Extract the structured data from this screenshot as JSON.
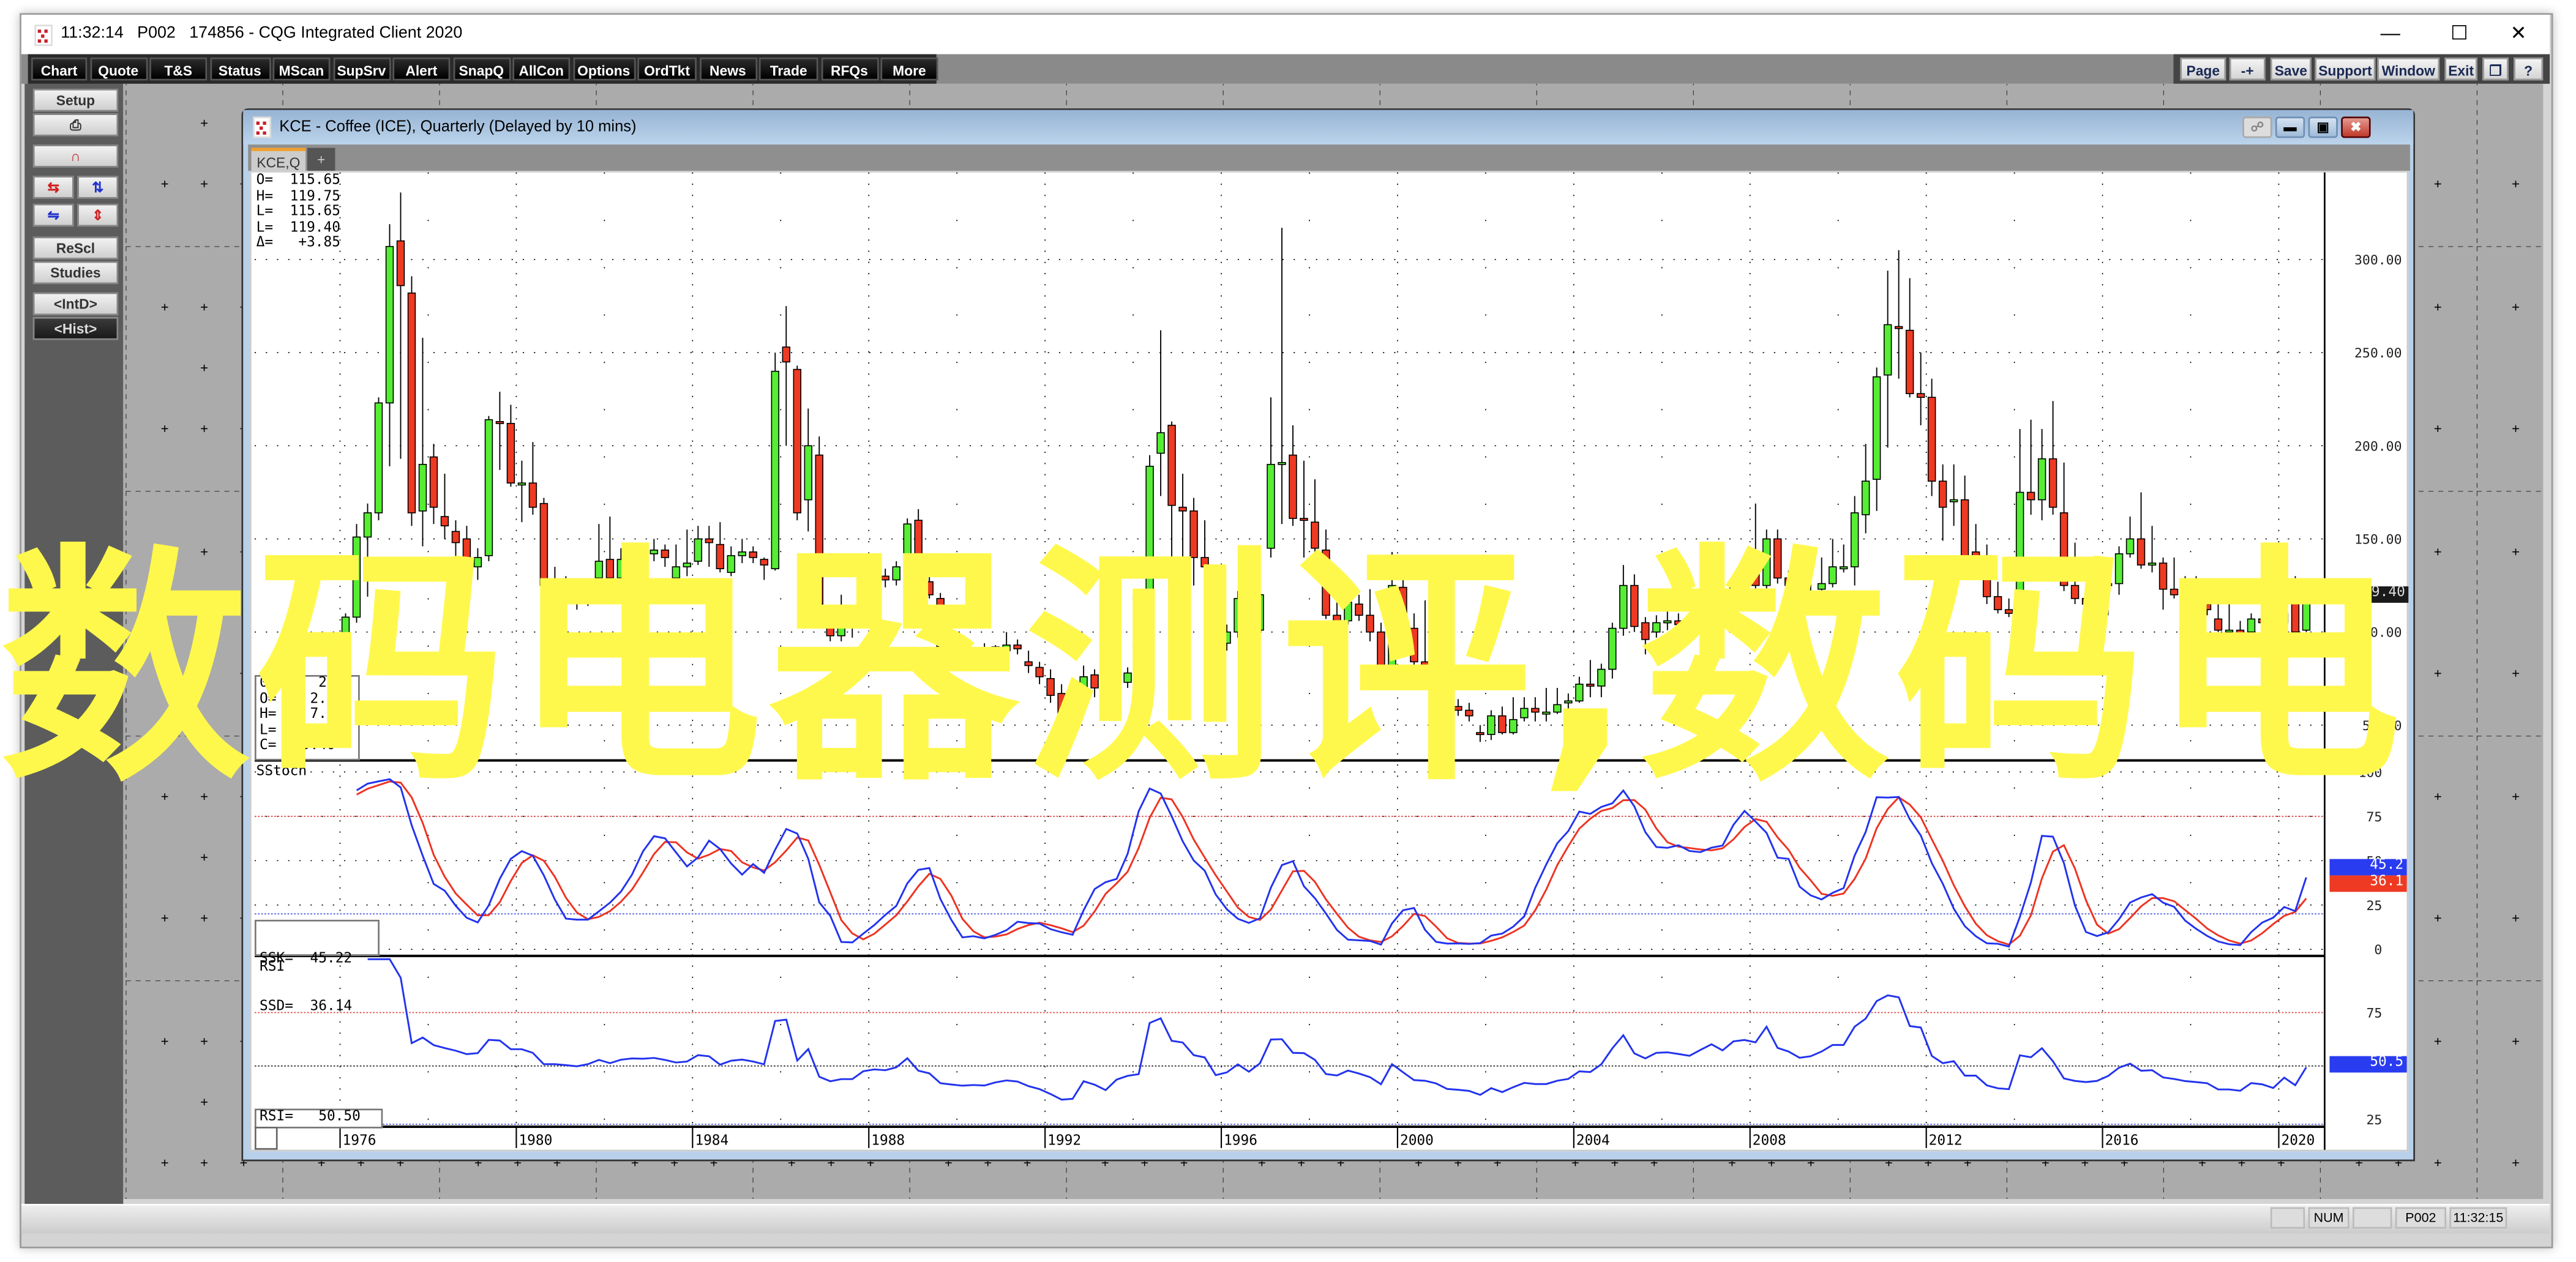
{
  "window": {
    "time": "11:32:14",
    "page": "P002",
    "title": "174856 - CQG Integrated Client 2020",
    "controls": [
      "minimize",
      "maximize",
      "close"
    ]
  },
  "toolbar": {
    "left_buttons": [
      "Chart",
      "Quote",
      "T&S",
      "Status",
      "MScan",
      "SupSrv",
      "Alert",
      "SnapQ",
      "AllCon",
      "Options",
      "OrdTkt",
      "News",
      "Trade",
      "RFQs",
      "More"
    ],
    "right_buttons": [
      "Page",
      "-+",
      "Save",
      "Support",
      "Window",
      "Exit",
      "❐",
      "?"
    ]
  },
  "left_panel": {
    "setup": "Setup",
    "print_icon": "printer-icon",
    "magnet_icon": "magnet-icon",
    "rescl": "ReScl",
    "studies": "Studies",
    "intd": "<IntD>",
    "hist": "<Hist>"
  },
  "chart_window": {
    "title": "KCE - Coffee (ICE), Quarterly (Delayed by 10 mins)",
    "tab": "KCE,Q",
    "add_tab": "+"
  },
  "readout_top": [
    {
      "label": "O=",
      "value": "115.65"
    },
    {
      "label": "H=",
      "value": "119.75"
    },
    {
      "label": "L=",
      "value": "115.65"
    },
    {
      "label": "L=",
      "value": "119.40"
    },
    {
      "label": "Δ=",
      "value": "+3.85"
    }
  ],
  "readout_bottom": [
    {
      "label": "01",
      "value": "20"
    },
    {
      "label": "O=",
      "value": "2.8"
    },
    {
      "label": "H=",
      "value": "7.2"
    },
    {
      "label": "L=",
      "value": ""
    },
    {
      "label": "C=",
      "value": "9.40"
    }
  ],
  "studies": {
    "sstoch_title": "SStoch",
    "ssk_label": "SSK=",
    "ssk_value": "45.22",
    "ssd_label": "SSD=",
    "ssd_value": "36.14",
    "ssk_tag": "45.2",
    "ssd_tag": "36.1",
    "rsi_title": "RSI",
    "rsi_label": "RSI=",
    "rsi_value": "50.50",
    "rsi_tag": "50.5"
  },
  "last_price_tag": "119.40",
  "watermark": "数码电器测评,数码电",
  "status_bar": {
    "num": "NUM",
    "page": "P002",
    "time": "11:32:15"
  },
  "colors": {
    "up": "#55ee33",
    "down": "#ee3a22",
    "ssk": "#2233ee",
    "ssd": "#ee3322",
    "rsi": "#2233ee",
    "watermark": "#fff84c",
    "accent": "#b8d0ea"
  },
  "chart_data": {
    "type": "candlestick",
    "symbol": "KCE",
    "interval": "quarterly",
    "first_bar": "1975-Q4",
    "ylim": [
      31,
      347
    ],
    "y_ticks": [
      "300.00",
      "250.00",
      "200.00",
      "150.00",
      "100.00",
      "50.00"
    ],
    "y_tick_values": [
      300,
      250,
      200,
      150,
      100,
      50
    ],
    "x_ticks": [
      "1976",
      "1980",
      "1984",
      "1988",
      "1992",
      "1996",
      "2000",
      "2004",
      "2008",
      "2012",
      "2016",
      "2020"
    ],
    "grid": true,
    "sstoch_ticks": [
      "100",
      "75",
      "50",
      "25",
      "0"
    ],
    "sstoch_levels": {
      "upper": 75,
      "lower": 20
    },
    "rsi_ticks": [
      "75",
      "25"
    ],
    "rsi_levels": {
      "upper": 75,
      "middle": 50,
      "lower": 25
    },
    "ohlc": [
      [
        79,
        88,
        76,
        86
      ],
      [
        86,
        110,
        84,
        108
      ],
      [
        108,
        158,
        105,
        151
      ],
      [
        151,
        169,
        119,
        164
      ],
      [
        164,
        226,
        160,
        223
      ],
      [
        223,
        319,
        189,
        307
      ],
      [
        310,
        336,
        193,
        286
      ],
      [
        282,
        291,
        157,
        164
      ],
      [
        165,
        258,
        146,
        190
      ],
      [
        194,
        201,
        158,
        167
      ],
      [
        162,
        185,
        150,
        157
      ],
      [
        154,
        160,
        106,
        148
      ],
      [
        150,
        157,
        120,
        135
      ],
      [
        135,
        145,
        128,
        140
      ],
      [
        141,
        216,
        138,
        214
      ],
      [
        213,
        229,
        187,
        212
      ],
      [
        212,
        222,
        178,
        180
      ],
      [
        180,
        192,
        159,
        180
      ],
      [
        180,
        202,
        163,
        167
      ],
      [
        169,
        172,
        117,
        125
      ],
      [
        126,
        135,
        100,
        125
      ],
      [
        125,
        130,
        112,
        122
      ],
      [
        122,
        126,
        112,
        118
      ],
      [
        118,
        128,
        114,
        125
      ],
      [
        129,
        158,
        120,
        138
      ],
      [
        139,
        162,
        120,
        129
      ],
      [
        129,
        145,
        126,
        139
      ],
      [
        138,
        145,
        125,
        143
      ],
      [
        143,
        148,
        136,
        142
      ],
      [
        142,
        150,
        138,
        144
      ],
      [
        144,
        147,
        135,
        140
      ],
      [
        129,
        147,
        125,
        135
      ],
      [
        135,
        155,
        130,
        137
      ],
      [
        138,
        157,
        136,
        150
      ],
      [
        150,
        157,
        135,
        148
      ],
      [
        147,
        159,
        132,
        134
      ],
      [
        132,
        146,
        130,
        141
      ],
      [
        141,
        150,
        137,
        143
      ],
      [
        143,
        146,
        137,
        140
      ],
      [
        139,
        140,
        128,
        136
      ],
      [
        134,
        250,
        133,
        240
      ],
      [
        253,
        275,
        200,
        245
      ],
      [
        241,
        243,
        160,
        164
      ],
      [
        171,
        220,
        154,
        200
      ],
      [
        195,
        205,
        105,
        115
      ],
      [
        110,
        112,
        95,
        98
      ],
      [
        98,
        120,
        95,
        104
      ],
      [
        104,
        110,
        97,
        104
      ],
      [
        117,
        140,
        112,
        125
      ],
      [
        125,
        133,
        120,
        130
      ],
      [
        130,
        134,
        124,
        128
      ],
      [
        128,
        138,
        125,
        135
      ],
      [
        128,
        161,
        120,
        158
      ],
      [
        160,
        166,
        122,
        127
      ],
      [
        127,
        135,
        118,
        120
      ],
      [
        118,
        121,
        88,
        92
      ],
      [
        92,
        95,
        80,
        88
      ],
      [
        88,
        92,
        82,
        85
      ],
      [
        85,
        90,
        82,
        86
      ],
      [
        86,
        94,
        83,
        85
      ],
      [
        92,
        93,
        86,
        90
      ],
      [
        90,
        100,
        88,
        93
      ],
      [
        93,
        96,
        88,
        91
      ],
      [
        84,
        90,
        78,
        82
      ],
      [
        81,
        84,
        72,
        76
      ],
      [
        75,
        80,
        62,
        66
      ],
      [
        67,
        72,
        52,
        54
      ],
      [
        55,
        62,
        50,
        55
      ],
      [
        66,
        82,
        60,
        76
      ],
      [
        77,
        80,
        65,
        70
      ],
      [
        58,
        70,
        53,
        60
      ],
      [
        60,
        80,
        58,
        73
      ],
      [
        73,
        81,
        70,
        78
      ],
      [
        70,
        82,
        68,
        80
      ],
      [
        80,
        195,
        78,
        189
      ],
      [
        196,
        262,
        173,
        207
      ],
      [
        211,
        213,
        118,
        168
      ],
      [
        167,
        185,
        140,
        165
      ],
      [
        165,
        172,
        125,
        140
      ],
      [
        140,
        160,
        130,
        135
      ],
      [
        119,
        130,
        92,
        94
      ],
      [
        94,
        104,
        90,
        100
      ],
      [
        100,
        122,
        97,
        118
      ],
      [
        123,
        136,
        98,
        101
      ],
      [
        101,
        125,
        99,
        120
      ],
      [
        145,
        226,
        140,
        190
      ],
      [
        190,
        317,
        158,
        191
      ],
      [
        195,
        211,
        157,
        161
      ],
      [
        161,
        192,
        140,
        160
      ],
      [
        159,
        182,
        137,
        145
      ],
      [
        144,
        155,
        107,
        109
      ],
      [
        109,
        120,
        100,
        105
      ],
      [
        106,
        125,
        104,
        116
      ],
      [
        115,
        120,
        106,
        109
      ],
      [
        109,
        123,
        95,
        100
      ],
      [
        100,
        105,
        80,
        82
      ],
      [
        82,
        143,
        80,
        125
      ],
      [
        124,
        128,
        102,
        105
      ],
      [
        102,
        110,
        82,
        84
      ],
      [
        84,
        117,
        80,
        82
      ],
      [
        82,
        95,
        72,
        75
      ],
      [
        66,
        70,
        58,
        60
      ],
      [
        60,
        64,
        55,
        58
      ],
      [
        58,
        62,
        52,
        55
      ],
      [
        46,
        50,
        41,
        45
      ],
      [
        45,
        58,
        42,
        55
      ],
      [
        55,
        60,
        45,
        46
      ],
      [
        46,
        65,
        45,
        53
      ],
      [
        54,
        65,
        52,
        59
      ],
      [
        59,
        65,
        52,
        57
      ],
      [
        57,
        70,
        52,
        57
      ],
      [
        57,
        70,
        56,
        61
      ],
      [
        62,
        67,
        55,
        63
      ],
      [
        63,
        76,
        62,
        72
      ],
      [
        72,
        85,
        65,
        71
      ],
      [
        71,
        83,
        65,
        80
      ],
      [
        80,
        105,
        75,
        102
      ],
      [
        102,
        136,
        98,
        125
      ],
      [
        125,
        131,
        100,
        103
      ],
      [
        105,
        108,
        88,
        96
      ],
      [
        100,
        109,
        97,
        105
      ],
      [
        106,
        115,
        101,
        106
      ],
      [
        106,
        110,
        100,
        104
      ],
      [
        104,
        108,
        98,
        102
      ],
      [
        102,
        113,
        100,
        110
      ],
      [
        110,
        121,
        107,
        118
      ],
      [
        118,
        120,
        100,
        112
      ],
      [
        110,
        128,
        108,
        125
      ],
      [
        125,
        132,
        122,
        127
      ],
      [
        134,
        169,
        122,
        125
      ],
      [
        125,
        155,
        122,
        150
      ],
      [
        150,
        155,
        126,
        129
      ],
      [
        129,
        133,
        122,
        125
      ],
      [
        125,
        128,
        115,
        118
      ],
      [
        118,
        135,
        116,
        120
      ],
      [
        123,
        140,
        120,
        126
      ],
      [
        126,
        150,
        124,
        135
      ],
      [
        135,
        147,
        132,
        135
      ],
      [
        135,
        173,
        125,
        164
      ],
      [
        163,
        201,
        153,
        181
      ],
      [
        182,
        242,
        165,
        237
      ],
      [
        238,
        294,
        199,
        265
      ],
      [
        264,
        305,
        236,
        263
      ],
      [
        262,
        290,
        226,
        228
      ],
      [
        228,
        250,
        211,
        226
      ],
      [
        226,
        236,
        173,
        181
      ],
      [
        181,
        190,
        149,
        167
      ],
      [
        171,
        190,
        157,
        171
      ],
      [
        171,
        184,
        138,
        141
      ],
      [
        143,
        158,
        130,
        141
      ],
      [
        136,
        147,
        115,
        119
      ],
      [
        119,
        127,
        110,
        112
      ],
      [
        112,
        118,
        108,
        110
      ],
      [
        121,
        209,
        110,
        175
      ],
      [
        175,
        214,
        163,
        171
      ],
      [
        171,
        209,
        160,
        193
      ],
      [
        193,
        224,
        163,
        167
      ],
      [
        164,
        191,
        122,
        125
      ],
      [
        125,
        148,
        115,
        118
      ],
      [
        118,
        124,
        112,
        115
      ],
      [
        115,
        122,
        110,
        117
      ],
      [
        125,
        135,
        109,
        126
      ],
      [
        126,
        146,
        120,
        142
      ],
      [
        142,
        162,
        140,
        150
      ],
      [
        150,
        175,
        134,
        136
      ],
      [
        137,
        157,
        132,
        137
      ],
      [
        137,
        140,
        112,
        123
      ],
      [
        123,
        140,
        118,
        120
      ],
      [
        120,
        130,
        114,
        116
      ],
      [
        116,
        130,
        112,
        114
      ],
      [
        115,
        118,
        109,
        112
      ],
      [
        107,
        115,
        100,
        101
      ],
      [
        101,
        125,
        99,
        101
      ],
      [
        101,
        106,
        97,
        99
      ],
      [
        100,
        110,
        97,
        107
      ],
      [
        107,
        111,
        102,
        105
      ],
      [
        105,
        108,
        96,
        100
      ],
      [
        105,
        112,
        100,
        110
      ],
      [
        124,
        130,
        98,
        100
      ],
      [
        101,
        123,
        100,
        119.4
      ]
    ]
  }
}
